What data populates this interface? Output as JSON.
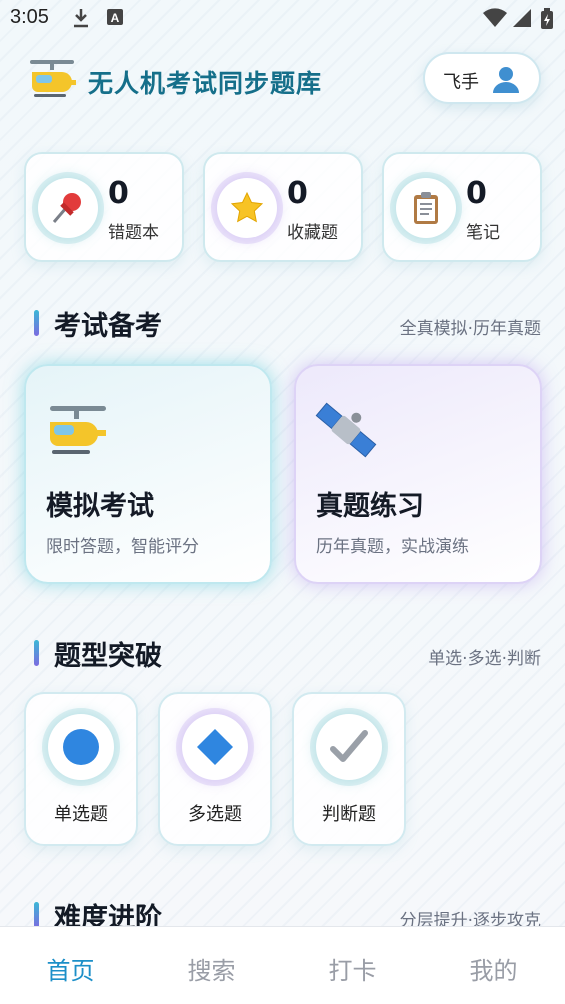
{
  "status_bar": {
    "time": "3:05",
    "icons": [
      "download-icon",
      "a-letter-icon",
      "wifi-icon",
      "signal-icon",
      "battery-icon"
    ]
  },
  "header": {
    "app_title": "无人机考试同步题库",
    "logo_icon": "helicopter-icon",
    "user": {
      "name": "飞手",
      "icon": "user-icon"
    }
  },
  "stats": [
    {
      "icon": "pushpin-icon",
      "value": "0",
      "label": "错题本"
    },
    {
      "icon": "star-icon",
      "value": "0",
      "label": "收藏题"
    },
    {
      "icon": "clipboard-icon",
      "value": "0",
      "label": "笔记"
    }
  ],
  "exam_section": {
    "title": "考试备考",
    "subtitle": "全真模拟·历年真题",
    "cards": [
      {
        "icon": "helicopter-icon",
        "title": "模拟考试",
        "desc": "限时答题，智能评分"
      },
      {
        "icon": "satellite-icon",
        "title": "真题练习",
        "desc": "历年真题，实战演练"
      }
    ]
  },
  "type_section": {
    "title": "题型突破",
    "subtitle": "单选·多选·判断",
    "items": [
      {
        "icon": "blue-circle-icon",
        "label": "单选题"
      },
      {
        "icon": "blue-diamond-icon",
        "label": "多选题"
      },
      {
        "icon": "check-mark-icon",
        "label": "判断题"
      }
    ]
  },
  "difficulty_section": {
    "title": "难度进阶",
    "subtitle": "分层提升·逐步攻克"
  },
  "bottom_nav": {
    "items": [
      "首页",
      "搜索",
      "打卡",
      "我的"
    ],
    "active_index": 0
  },
  "colors": {
    "accent": "#1c8fc8",
    "title_teal": "#156f8a",
    "glow_teal": "#5ac8d7",
    "glow_purple": "#aa8ceb"
  }
}
